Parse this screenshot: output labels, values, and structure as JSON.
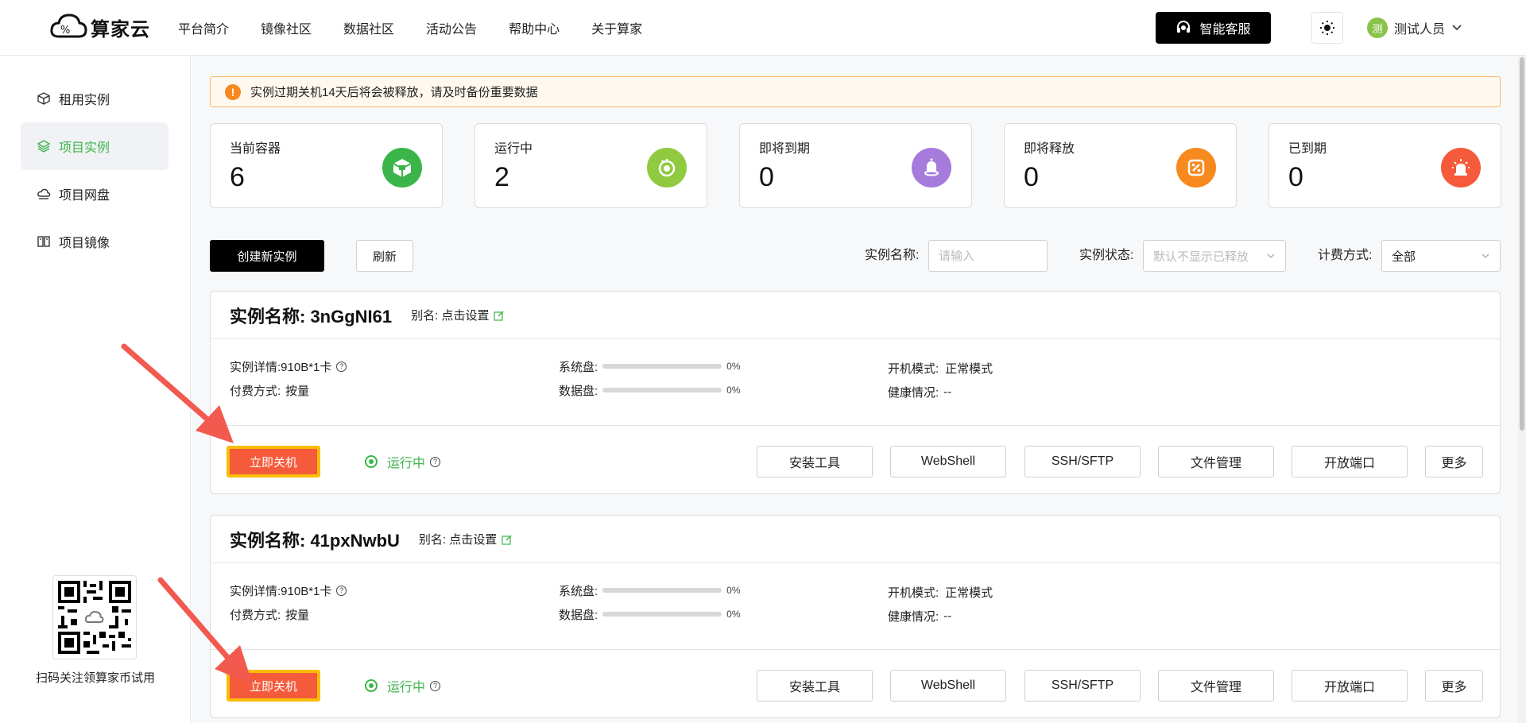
{
  "header": {
    "brand": "算家云",
    "nav": [
      "平台简介",
      "镜像社区",
      "数据社区",
      "活动公告",
      "帮助中心",
      "关于算家"
    ],
    "service_label": "智能客服",
    "user_name": "测试人员",
    "avatar_char": "测"
  },
  "sidebar": {
    "items": [
      {
        "label": "租用实例",
        "icon": "cube-icon"
      },
      {
        "label": "项目实例",
        "icon": "layers-icon",
        "active": true
      },
      {
        "label": "项目网盘",
        "icon": "cloud-drive-icon"
      },
      {
        "label": "项目镜像",
        "icon": "image-icon"
      }
    ],
    "qr_caption": "扫码关注领算家币试用"
  },
  "notice": "实例过期关机14天后将会被释放，请及时备份重要数据",
  "stats": [
    {
      "label": "当前容器",
      "value": "6",
      "color": "#3bb54a",
      "icon": "container-icon"
    },
    {
      "label": "运行中",
      "value": "2",
      "color": "#8fca3f",
      "icon": "running-icon"
    },
    {
      "label": "即将到期",
      "value": "0",
      "color": "#a67bdc",
      "icon": "bell-icon"
    },
    {
      "label": "即将释放",
      "value": "0",
      "color": "#f7891f",
      "icon": "release-icon"
    },
    {
      "label": "已到期",
      "value": "0",
      "color": "#f55a3a",
      "icon": "alarm-icon"
    }
  ],
  "toolbar": {
    "create_label": "创建新实例",
    "refresh_label": "刷新",
    "name_label": "实例名称:",
    "name_placeholder": "请输入",
    "state_label": "实例状态:",
    "state_value": "默认不显示已释放",
    "billing_label": "计费方式:",
    "billing_value": "全部"
  },
  "instances": [
    {
      "title": "实例名称: 3nGgNI61",
      "alias": "别名: 点击设置",
      "detail_label": "实例详情: ",
      "detail_value": "910B*1卡",
      "pay_label": "付费方式: ",
      "pay_value": "按量",
      "sys_disk_label": "系统盘:",
      "sys_disk_pct": "0%",
      "data_disk_label": "数据盘:",
      "data_disk_pct": "0%",
      "boot_label": "开机模式: ",
      "boot_value": "正常模式",
      "health_label": "健康情况: ",
      "health_value": "--",
      "stop_label": "立即关机",
      "status": "运行中",
      "actions": [
        "安装工具",
        "WebShell",
        "SSH/SFTP",
        "文件管理",
        "开放端口",
        "更多"
      ]
    },
    {
      "title": "实例名称: 41pxNwbU",
      "alias": "别名: 点击设置",
      "detail_label": "实例详情: ",
      "detail_value": "910B*1卡",
      "pay_label": "付费方式: ",
      "pay_value": "按量",
      "sys_disk_label": "系统盘:",
      "sys_disk_pct": "0%",
      "data_disk_label": "数据盘:",
      "data_disk_pct": "0%",
      "boot_label": "开机模式: ",
      "boot_value": "正常模式",
      "health_label": "健康情况: ",
      "health_value": "--",
      "stop_label": "立即关机",
      "status": "运行中",
      "actions": [
        "安装工具",
        "WebShell",
        "SSH/SFTP",
        "文件管理",
        "开放端口",
        "更多"
      ]
    }
  ]
}
